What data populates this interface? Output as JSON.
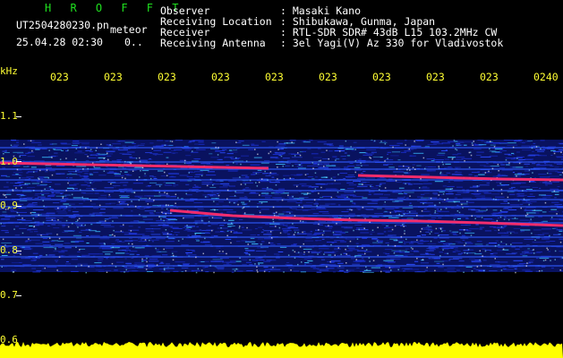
{
  "header": {
    "program": "H R O F F T",
    "filename": "UT2504280230.pn",
    "mode": "meteor",
    "datetime": "25.04.28 02:30",
    "status_glyph": "0..",
    "info": [
      {
        "label": "Observer",
        "value": ": Masaki Kano"
      },
      {
        "label": "Receiving Location",
        "value": ": Shibukawa, Gunma, Japan"
      },
      {
        "label": "Receiver",
        "value": ": RTL-SDR SDR# 43dB L15 103.2MHz CW"
      },
      {
        "label": "Receiving Antenna",
        "value": ": 3el Yagi(V) Az 330 for Vladivostok"
      }
    ]
  },
  "time_axis": {
    "ticks": [
      "023",
      "023",
      "023",
      "023",
      "023",
      "023",
      "023",
      "023",
      "023",
      "0240"
    ]
  },
  "freq_axis": {
    "unit": "kHz",
    "labels": [
      "1.1",
      "1.0",
      "0.9",
      "0.8",
      "0.7",
      "0.6"
    ]
  },
  "colors": {
    "background": "#000000",
    "noise_band": "#1b2fcf",
    "signal_trace": "#ff2d6a",
    "amplitude_bar": "#ffff00",
    "program_title": "#1fe01f"
  }
}
